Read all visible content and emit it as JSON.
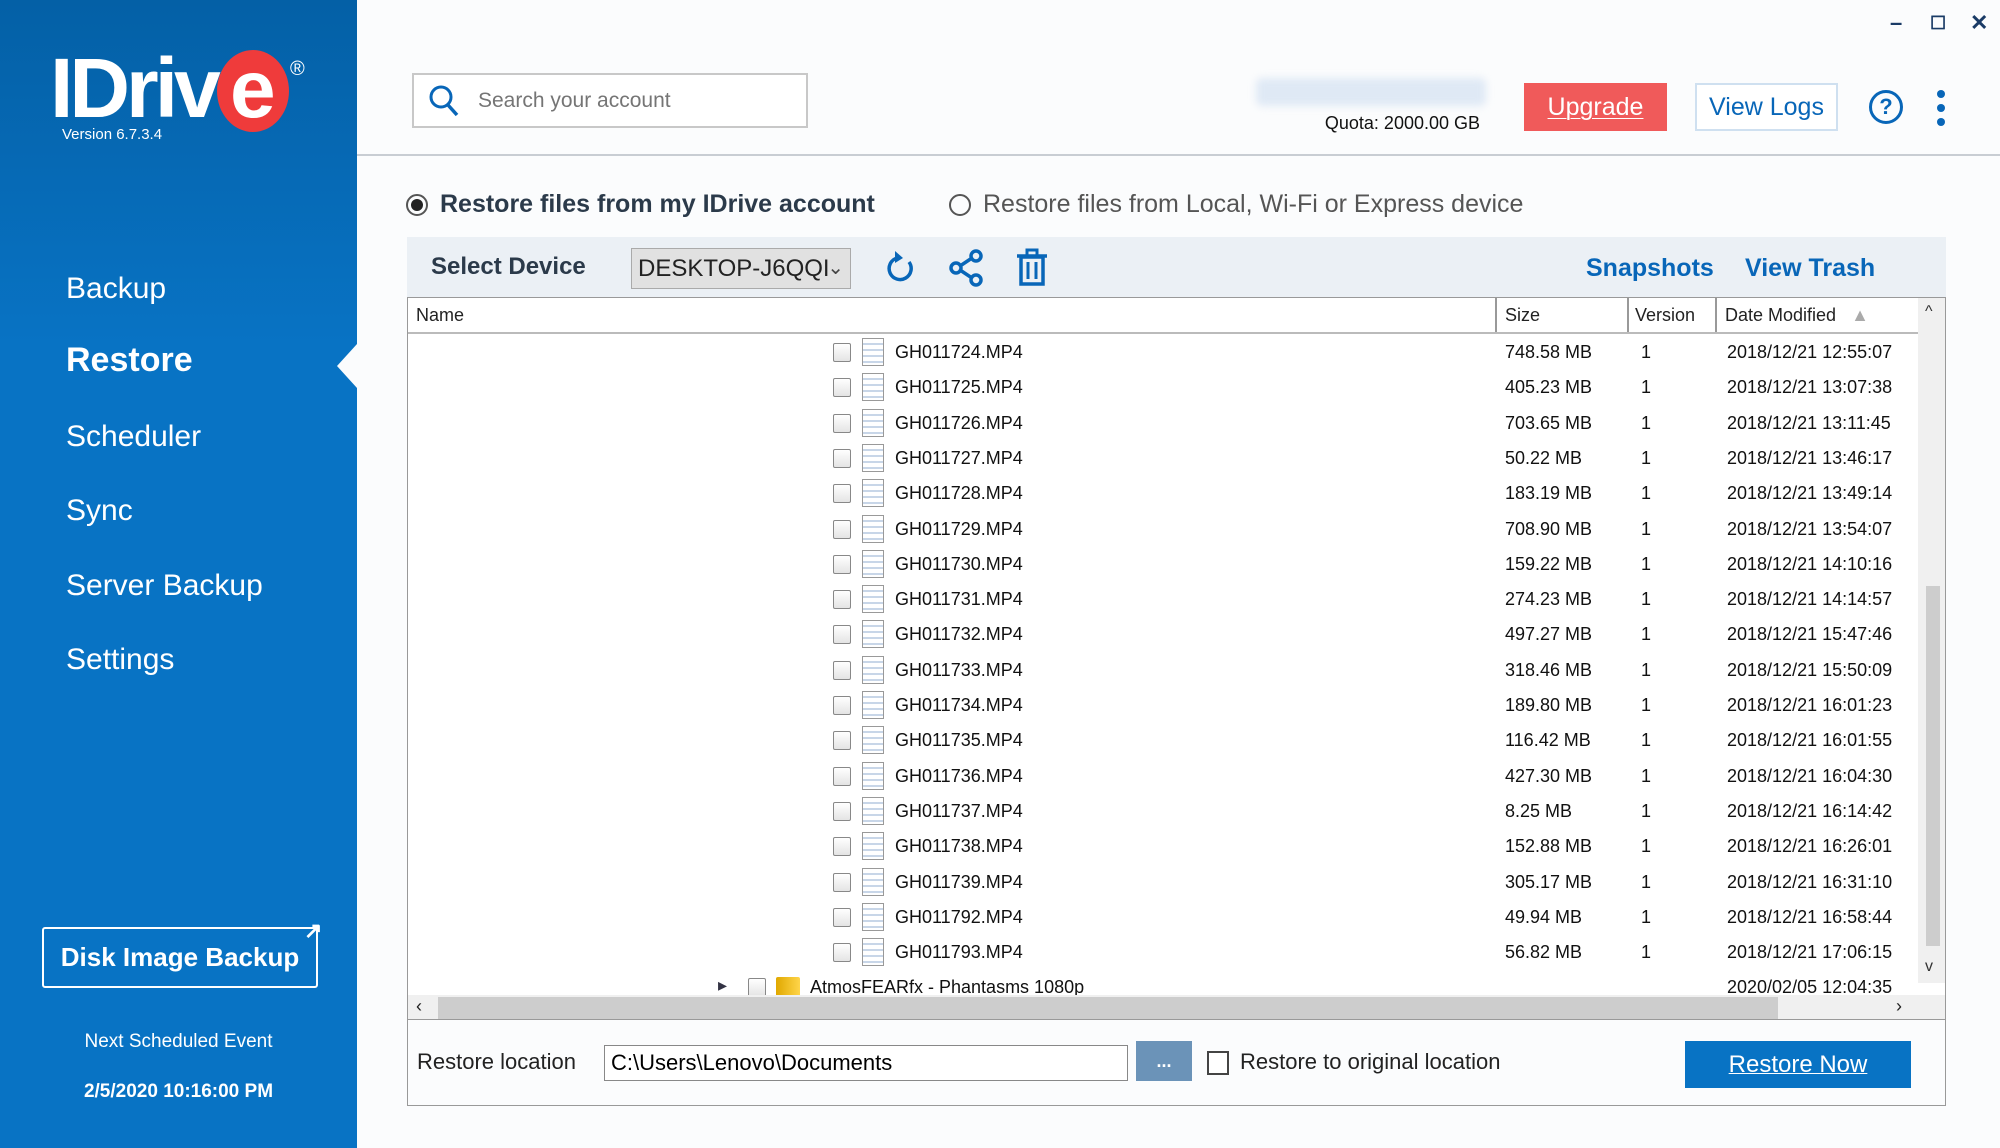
{
  "app": {
    "logo_text": "IDrive",
    "version": "Version  6.7.3.4"
  },
  "colors": {
    "sidebar": "#0873c4",
    "accent": "#0866b8",
    "upgrade": "#f05a5a",
    "restore_now": "#0873c4"
  },
  "sidebar": {
    "items": [
      {
        "label": "Backup"
      },
      {
        "label": "Restore",
        "active": true
      },
      {
        "label": "Scheduler"
      },
      {
        "label": "Sync"
      },
      {
        "label": "Server Backup"
      },
      {
        "label": "Settings"
      }
    ],
    "disk_image_backup": "Disk Image Backup",
    "next_event_label": "Next Scheduled Event",
    "next_event_time": "2/5/2020 10:16:00 PM"
  },
  "header": {
    "search_placeholder": "Search your account",
    "quota": "Quota: 2000.00 GB",
    "upgrade": "Upgrade",
    "view_logs": "View Logs",
    "help": "?"
  },
  "restore": {
    "option_account": "Restore files from my IDrive account",
    "option_local": "Restore files from Local, Wi-Fi or Express device",
    "selected_option": "account",
    "select_device_label": "Select Device",
    "device": "DESKTOP-J6QQI",
    "snapshots": "Snapshots",
    "view_trash": "View Trash"
  },
  "table": {
    "columns": [
      "Name",
      "Size",
      "Version",
      "Date Modified"
    ],
    "sort": "Date Modified ascending",
    "rows": [
      {
        "name": "GH011724.MP4",
        "size": "748.58 MB",
        "version": "1",
        "date": "2018/12/21 12:55:07"
      },
      {
        "name": "GH011725.MP4",
        "size": "405.23 MB",
        "version": "1",
        "date": "2018/12/21 13:07:38"
      },
      {
        "name": "GH011726.MP4",
        "size": "703.65 MB",
        "version": "1",
        "date": "2018/12/21 13:11:45"
      },
      {
        "name": "GH011727.MP4",
        "size": "50.22 MB",
        "version": "1",
        "date": "2018/12/21 13:46:17"
      },
      {
        "name": "GH011728.MP4",
        "size": "183.19 MB",
        "version": "1",
        "date": "2018/12/21 13:49:14"
      },
      {
        "name": "GH011729.MP4",
        "size": "708.90 MB",
        "version": "1",
        "date": "2018/12/21 13:54:07"
      },
      {
        "name": "GH011730.MP4",
        "size": "159.22 MB",
        "version": "1",
        "date": "2018/12/21 14:10:16"
      },
      {
        "name": "GH011731.MP4",
        "size": "274.23 MB",
        "version": "1",
        "date": "2018/12/21 14:14:57"
      },
      {
        "name": "GH011732.MP4",
        "size": "497.27 MB",
        "version": "1",
        "date": "2018/12/21 15:47:46"
      },
      {
        "name": "GH011733.MP4",
        "size": "318.46 MB",
        "version": "1",
        "date": "2018/12/21 15:50:09"
      },
      {
        "name": "GH011734.MP4",
        "size": "189.80 MB",
        "version": "1",
        "date": "2018/12/21 16:01:23"
      },
      {
        "name": "GH011735.MP4",
        "size": "116.42 MB",
        "version": "1",
        "date": "2018/12/21 16:01:55"
      },
      {
        "name": "GH011736.MP4",
        "size": "427.30 MB",
        "version": "1",
        "date": "2018/12/21 16:04:30"
      },
      {
        "name": "GH011737.MP4",
        "size": "8.25 MB",
        "version": "1",
        "date": "2018/12/21 16:14:42"
      },
      {
        "name": "GH011738.MP4",
        "size": "152.88 MB",
        "version": "1",
        "date": "2018/12/21 16:26:01"
      },
      {
        "name": "GH011739.MP4",
        "size": "305.17 MB",
        "version": "1",
        "date": "2018/12/21 16:31:10"
      },
      {
        "name": "GH011792.MP4",
        "size": "49.94 MB",
        "version": "1",
        "date": "2018/12/21 16:58:44"
      },
      {
        "name": "GH011793.MP4",
        "size": "56.82 MB",
        "version": "1",
        "date": "2018/12/21 17:06:15"
      }
    ],
    "folder_row": {
      "name": "AtmosFEARfx - Phantasms 1080p",
      "size": "",
      "version": "",
      "date": "2020/02/05 12:04:35"
    }
  },
  "footer": {
    "restore_location_label": "Restore location",
    "restore_location": "C:\\Users\\Lenovo\\Documents",
    "browse": "...",
    "restore_original": "Restore to original location",
    "restore_now": "Restore Now"
  }
}
